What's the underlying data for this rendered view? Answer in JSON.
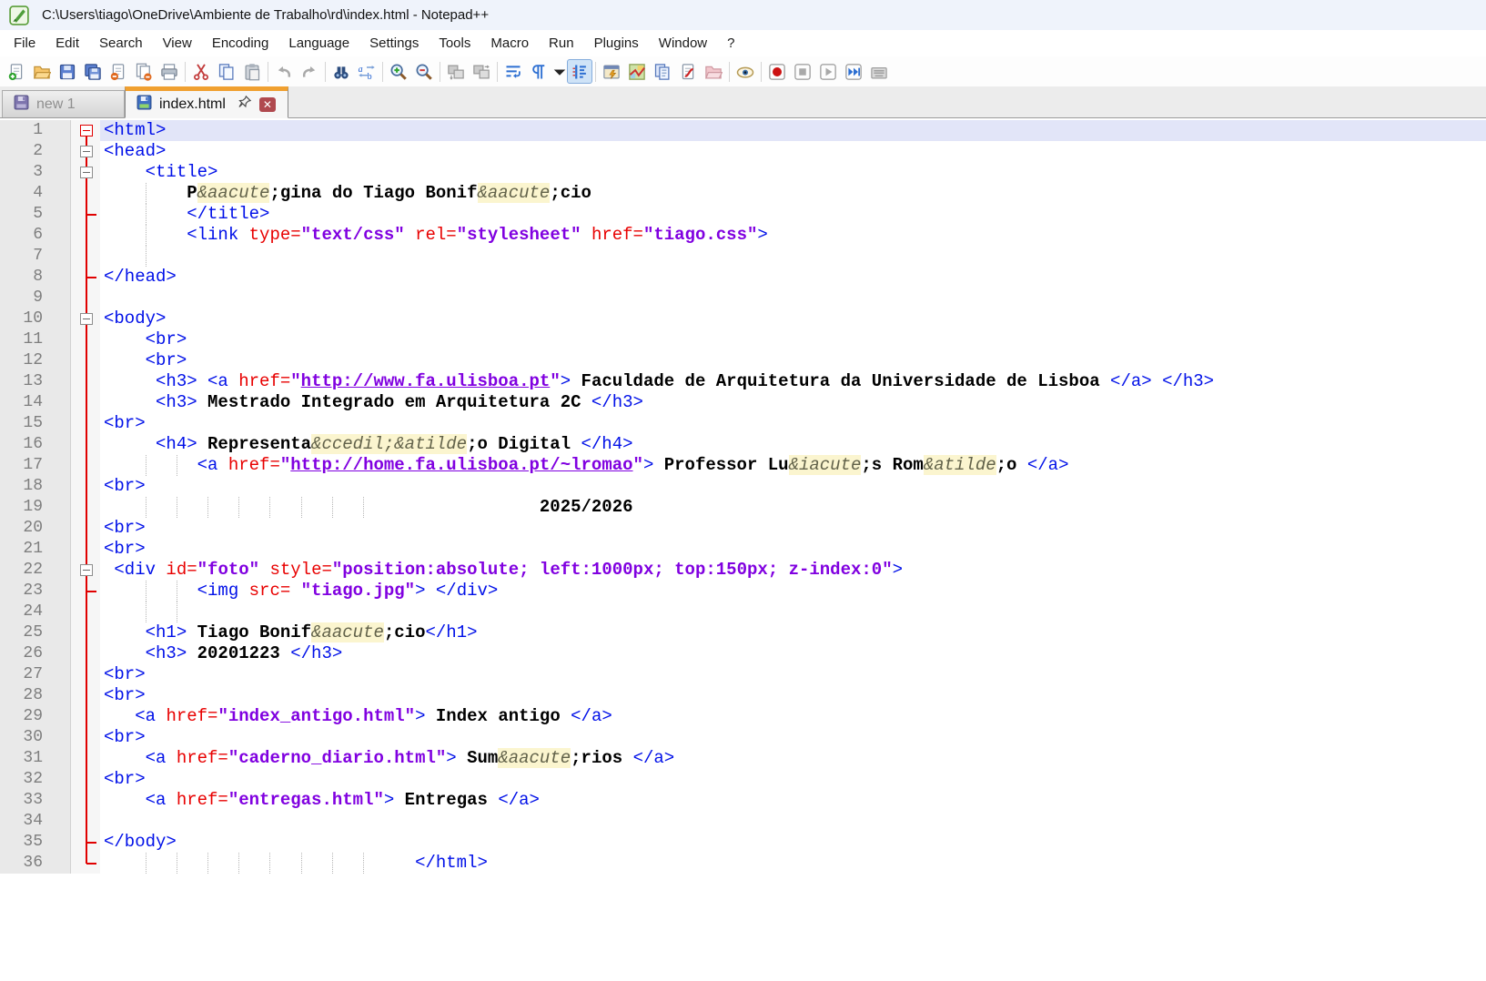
{
  "titlebar": {
    "title": "C:\\Users\\tiago\\OneDrive\\Ambiente de Trabalho\\rd\\index.html - Notepad++"
  },
  "menubar": {
    "items": [
      "File",
      "Edit",
      "Search",
      "View",
      "Encoding",
      "Language",
      "Settings",
      "Tools",
      "Macro",
      "Run",
      "Plugins",
      "Window",
      "?"
    ]
  },
  "toolbar": {
    "items": [
      {
        "icon": "new-file"
      },
      {
        "icon": "open-file"
      },
      {
        "icon": "save"
      },
      {
        "icon": "save-all"
      },
      {
        "icon": "close-file"
      },
      {
        "icon": "close-all"
      },
      {
        "icon": "print"
      },
      {
        "sep": true
      },
      {
        "icon": "cut"
      },
      {
        "icon": "copy"
      },
      {
        "icon": "paste"
      },
      {
        "sep": true
      },
      {
        "icon": "undo"
      },
      {
        "icon": "redo"
      },
      {
        "sep": true
      },
      {
        "icon": "find"
      },
      {
        "icon": "replace"
      },
      {
        "sep": true
      },
      {
        "icon": "zoom-in"
      },
      {
        "icon": "zoom-out"
      },
      {
        "sep": true
      },
      {
        "icon": "sync-vertical"
      },
      {
        "icon": "sync-horizontal"
      },
      {
        "sep": true
      },
      {
        "icon": "word-wrap"
      },
      {
        "icon": "show-all-chars"
      },
      {
        "icon": "chevron-down",
        "narrow": true
      },
      {
        "icon": "indent-guide",
        "active": true
      },
      {
        "sep": true
      },
      {
        "icon": "user-commands"
      },
      {
        "icon": "document-map"
      },
      {
        "icon": "document-list"
      },
      {
        "icon": "function-list"
      },
      {
        "icon": "folder-workspace"
      },
      {
        "sep": true
      },
      {
        "icon": "preview-eye"
      },
      {
        "sep": true
      },
      {
        "icon": "record-macro"
      },
      {
        "icon": "stop-macro"
      },
      {
        "icon": "play-macro"
      },
      {
        "icon": "run-macro-multiple"
      },
      {
        "icon": "save-macro"
      }
    ]
  },
  "tabbar": {
    "tabs": [
      {
        "label": "new 1",
        "state": "inactive",
        "file_icon": "floppy-inactive"
      },
      {
        "label": "index.html",
        "state": "active",
        "file_icon": "floppy-saved",
        "pin": true,
        "close": true
      }
    ]
  },
  "colors": {
    "accent_orange": "#f0a030",
    "fold_red": "#e00000",
    "caret_line_bg": "#e2e5f8",
    "tag": "#0010e8",
    "attribute": "#e80000",
    "value": "#8000e0",
    "text": "#000000",
    "entity": "#62624a",
    "entity_bg": "#fbf5cf",
    "close_button_bg": "#b0494f"
  },
  "editor": {
    "lines": [
      {
        "n": 1,
        "caret": true,
        "fold": "box-red",
        "spine": "lower",
        "tokens": [
          [
            "tag",
            "<html>"
          ]
        ]
      },
      {
        "n": 2,
        "fold": "box",
        "tokens": [
          [
            "tag",
            "<head>"
          ]
        ]
      },
      {
        "n": 3,
        "fold": "box",
        "tokens": [
          [
            "ws",
            "    "
          ],
          [
            "tag",
            "<title>"
          ]
        ]
      },
      {
        "n": 4,
        "guides": [
          4
        ],
        "tokens": [
          [
            "ws",
            "        "
          ],
          [
            "txt",
            "P"
          ],
          [
            "ent",
            "&aacute"
          ],
          [
            "txt",
            ";gina do Tiago Bonif"
          ],
          [
            "ent",
            "&aacute"
          ],
          [
            "txt",
            ";cio"
          ]
        ]
      },
      {
        "n": 5,
        "fold": "tick",
        "guides": [
          4
        ],
        "tokens": [
          [
            "ws",
            "        "
          ],
          [
            "tag",
            "</title>"
          ]
        ]
      },
      {
        "n": 6,
        "guides": [
          4
        ],
        "tokens": [
          [
            "ws",
            "        "
          ],
          [
            "tag",
            "<link "
          ],
          [
            "attr",
            "type="
          ],
          [
            "val",
            "\"text/css\""
          ],
          [
            "ws",
            " "
          ],
          [
            "attr",
            "rel="
          ],
          [
            "val",
            "\"stylesheet\""
          ],
          [
            "ws",
            " "
          ],
          [
            "attr",
            "href="
          ],
          [
            "val",
            "\"tiago.css\""
          ],
          [
            "tag",
            ">"
          ]
        ]
      },
      {
        "n": 7,
        "guides": [
          4
        ],
        "tokens": []
      },
      {
        "n": 8,
        "fold": "tick",
        "tokens": [
          [
            "tag",
            "</head>"
          ]
        ]
      },
      {
        "n": 9,
        "tokens": []
      },
      {
        "n": 10,
        "fold": "box",
        "tokens": [
          [
            "tag",
            "<body>"
          ]
        ]
      },
      {
        "n": 11,
        "tokens": [
          [
            "ws",
            "    "
          ],
          [
            "tag",
            "<br>"
          ]
        ]
      },
      {
        "n": 12,
        "tokens": [
          [
            "ws",
            "    "
          ],
          [
            "tag",
            "<br>"
          ]
        ]
      },
      {
        "n": 13,
        "tokens": [
          [
            "ws",
            "     "
          ],
          [
            "tag",
            "<h3>"
          ],
          [
            "ws",
            " "
          ],
          [
            "tag",
            "<a "
          ],
          [
            "attr",
            "href="
          ],
          [
            "val",
            "\""
          ],
          [
            "url",
            "http://www.fa.ulisboa.pt"
          ],
          [
            "val",
            "\""
          ],
          [
            "tag",
            ">"
          ],
          [
            "txt",
            " Faculdade de Arquitetura da Universidade de Lisboa "
          ],
          [
            "tag",
            "</a>"
          ],
          [
            "ws",
            " "
          ],
          [
            "tag",
            "</h3>"
          ]
        ]
      },
      {
        "n": 14,
        "tokens": [
          [
            "ws",
            "     "
          ],
          [
            "tag",
            "<h3>"
          ],
          [
            "txt",
            " Mestrado Integrado em Arquitetura 2C "
          ],
          [
            "tag",
            "</h3>"
          ]
        ]
      },
      {
        "n": 15,
        "tokens": [
          [
            "tag",
            "<br>"
          ]
        ]
      },
      {
        "n": 16,
        "tokens": [
          [
            "ws",
            "     "
          ],
          [
            "tag",
            "<h4>"
          ],
          [
            "txt",
            " Representa"
          ],
          [
            "ent",
            "&ccedil;&atilde"
          ],
          [
            "txt",
            ";o Digital "
          ],
          [
            "tag",
            "</h4>"
          ]
        ]
      },
      {
        "n": 17,
        "guides": [
          4,
          7
        ],
        "tokens": [
          [
            "ws",
            "         "
          ],
          [
            "tag",
            "<a "
          ],
          [
            "attr",
            "href="
          ],
          [
            "val",
            "\""
          ],
          [
            "url",
            "http://home.fa.ulisboa.pt/~lromao"
          ],
          [
            "val",
            "\""
          ],
          [
            "tag",
            ">"
          ],
          [
            "txt",
            " Professor Lu"
          ],
          [
            "ent",
            "&iacute"
          ],
          [
            "txt",
            ";s Rom"
          ],
          [
            "ent",
            "&atilde"
          ],
          [
            "txt",
            ";o "
          ],
          [
            "tag",
            "</a>"
          ]
        ]
      },
      {
        "n": 18,
        "tokens": [
          [
            "tag",
            "<br>"
          ]
        ]
      },
      {
        "n": 19,
        "guides": [
          4,
          7,
          10,
          13,
          16,
          19,
          22,
          25
        ],
        "tokens": [
          [
            "ws",
            "                                          "
          ],
          [
            "txt",
            "2025/2026"
          ]
        ]
      },
      {
        "n": 20,
        "tokens": [
          [
            "tag",
            "<br>"
          ]
        ]
      },
      {
        "n": 21,
        "tokens": [
          [
            "tag",
            "<br>"
          ]
        ]
      },
      {
        "n": 22,
        "fold": "box",
        "tokens": [
          [
            "ws",
            " "
          ],
          [
            "tag",
            "<div "
          ],
          [
            "attr",
            "id="
          ],
          [
            "val",
            "\"foto\""
          ],
          [
            "ws",
            " "
          ],
          [
            "attr",
            "style="
          ],
          [
            "val",
            "\"position:absolute; left:1000px; top:150px; z-index:0\""
          ],
          [
            "tag",
            ">"
          ]
        ]
      },
      {
        "n": 23,
        "fold": "tick",
        "guides": [
          4,
          7
        ],
        "tokens": [
          [
            "ws",
            "         "
          ],
          [
            "tag",
            "<img "
          ],
          [
            "attr",
            "src= "
          ],
          [
            "val",
            "\"tiago.jpg\""
          ],
          [
            "tag",
            ">"
          ],
          [
            "ws",
            " "
          ],
          [
            "tag",
            "</div>"
          ]
        ]
      },
      {
        "n": 24,
        "guides": [
          4,
          7
        ],
        "tokens": []
      },
      {
        "n": 25,
        "tokens": [
          [
            "ws",
            "    "
          ],
          [
            "tag",
            "<h1>"
          ],
          [
            "txt",
            " Tiago Bonif"
          ],
          [
            "ent",
            "&aacute"
          ],
          [
            "txt",
            ";cio"
          ],
          [
            "tag",
            "</h1>"
          ]
        ]
      },
      {
        "n": 26,
        "tokens": [
          [
            "ws",
            "    "
          ],
          [
            "tag",
            "<h3>"
          ],
          [
            "txt",
            " 20201223 "
          ],
          [
            "tag",
            "</h3>"
          ]
        ]
      },
      {
        "n": 27,
        "tokens": [
          [
            "tag",
            "<br>"
          ]
        ]
      },
      {
        "n": 28,
        "tokens": [
          [
            "tag",
            "<br>"
          ]
        ]
      },
      {
        "n": 29,
        "tokens": [
          [
            "ws",
            "   "
          ],
          [
            "tag",
            "<a "
          ],
          [
            "attr",
            "href="
          ],
          [
            "val",
            "\"index_antigo.html\""
          ],
          [
            "tag",
            ">"
          ],
          [
            "txt",
            " Index antigo "
          ],
          [
            "tag",
            "</a>"
          ]
        ]
      },
      {
        "n": 30,
        "tokens": [
          [
            "tag",
            "<br>"
          ]
        ]
      },
      {
        "n": 31,
        "tokens": [
          [
            "ws",
            "    "
          ],
          [
            "tag",
            "<a "
          ],
          [
            "attr",
            "href="
          ],
          [
            "val",
            "\"caderno_diario.html\""
          ],
          [
            "tag",
            ">"
          ],
          [
            "txt",
            " Sum"
          ],
          [
            "ent",
            "&aacute"
          ],
          [
            "txt",
            ";rios "
          ],
          [
            "tag",
            "</a>"
          ]
        ]
      },
      {
        "n": 32,
        "tokens": [
          [
            "tag",
            "<br>"
          ]
        ]
      },
      {
        "n": 33,
        "tokens": [
          [
            "ws",
            "    "
          ],
          [
            "tag",
            "<a "
          ],
          [
            "attr",
            "href="
          ],
          [
            "val",
            "\"entregas.html\""
          ],
          [
            "tag",
            ">"
          ],
          [
            "txt",
            " Entregas "
          ],
          [
            "tag",
            "</a>"
          ]
        ]
      },
      {
        "n": 34,
        "tokens": []
      },
      {
        "n": 35,
        "fold": "tick",
        "tokens": [
          [
            "tag",
            "</body>"
          ]
        ]
      },
      {
        "n": 36,
        "fold": "corner",
        "spine": "upper",
        "guides": [
          4,
          7,
          10,
          13,
          16,
          19,
          22,
          25
        ],
        "tokens": [
          [
            "ws",
            "                              "
          ],
          [
            "tag",
            "</html>"
          ]
        ]
      }
    ]
  }
}
